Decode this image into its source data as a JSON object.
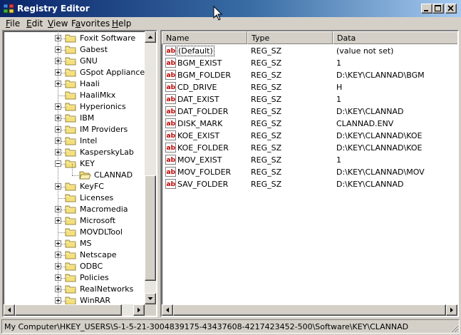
{
  "window": {
    "title": "Registry Editor"
  },
  "menu": [
    {
      "label": "File",
      "mnemonic": "F",
      "rest": "ile"
    },
    {
      "label": "Edit",
      "mnemonic": "E",
      "rest": "dit"
    },
    {
      "label": "View",
      "mnemonic": "V",
      "rest": "iew"
    },
    {
      "label": "Favorites",
      "mnemonic": "a",
      "pre": "F",
      "rest": "vorites"
    },
    {
      "label": "Help",
      "mnemonic": "H",
      "rest": "elp"
    }
  ],
  "tree": {
    "items": [
      {
        "label": "Foxit Software",
        "expander": "plus",
        "level": 0
      },
      {
        "label": "Gabest",
        "expander": "plus",
        "level": 0
      },
      {
        "label": "GNU",
        "expander": "plus",
        "level": 0
      },
      {
        "label": "GSpot Appliance Co",
        "expander": "plus",
        "level": 0
      },
      {
        "label": "Haali",
        "expander": "plus",
        "level": 0
      },
      {
        "label": "HaaliMkx",
        "expander": "none",
        "level": 0
      },
      {
        "label": "Hyperionics",
        "expander": "plus",
        "level": 0
      },
      {
        "label": "IBM",
        "expander": "plus",
        "level": 0
      },
      {
        "label": "IM Providers",
        "expander": "plus",
        "level": 0
      },
      {
        "label": "Intel",
        "expander": "plus",
        "level": 0
      },
      {
        "label": "KasperskyLab",
        "expander": "plus",
        "level": 0
      },
      {
        "label": "KEY",
        "expander": "minus",
        "level": 0
      },
      {
        "label": "CLANNAD",
        "expander": "none",
        "level": 1,
        "open": true
      },
      {
        "label": "KeyFC",
        "expander": "plus",
        "level": 0
      },
      {
        "label": "Licenses",
        "expander": "none",
        "level": 0
      },
      {
        "label": "Macromedia",
        "expander": "plus",
        "level": 0
      },
      {
        "label": "Microsoft",
        "expander": "plus",
        "level": 0
      },
      {
        "label": "MOVDLTool",
        "expander": "none",
        "level": 0
      },
      {
        "label": "MS",
        "expander": "plus",
        "level": 0
      },
      {
        "label": "Netscape",
        "expander": "plus",
        "level": 0
      },
      {
        "label": "ODBC",
        "expander": "plus",
        "level": 0
      },
      {
        "label": "Policies",
        "expander": "plus",
        "level": 0
      },
      {
        "label": "RealNetworks",
        "expander": "plus",
        "level": 0
      },
      {
        "label": "WinRAR",
        "expander": "plus",
        "level": 0
      }
    ]
  },
  "list": {
    "columns": {
      "name": "Name",
      "type": "Type",
      "data": "Data"
    },
    "rows": [
      {
        "name": "(Default)",
        "type": "REG_SZ",
        "data": "(value not set)"
      },
      {
        "name": "BGM_EXIST",
        "type": "REG_SZ",
        "data": "1"
      },
      {
        "name": "BGM_FOLDER",
        "type": "REG_SZ",
        "data": "D:\\KEY\\CLANNAD\\BGM"
      },
      {
        "name": "CD_DRIVE",
        "type": "REG_SZ",
        "data": "H"
      },
      {
        "name": "DAT_EXIST",
        "type": "REG_SZ",
        "data": "1"
      },
      {
        "name": "DAT_FOLDER",
        "type": "REG_SZ",
        "data": "D:\\KEY\\CLANNAD"
      },
      {
        "name": "DISK_MARK",
        "type": "REG_SZ",
        "data": "CLANNAD.ENV"
      },
      {
        "name": "KOE_EXIST",
        "type": "REG_SZ",
        "data": "D:\\KEY\\CLANNAD\\KOE"
      },
      {
        "name": "KOE_FOLDER",
        "type": "REG_SZ",
        "data": "D:\\KEY\\CLANNAD\\KOE"
      },
      {
        "name": "MOV_EXIST",
        "type": "REG_SZ",
        "data": "1"
      },
      {
        "name": "MOV_FOLDER",
        "type": "REG_SZ",
        "data": "D:\\KEY\\CLANNAD\\MOV"
      },
      {
        "name": "SAV_FOLDER",
        "type": "REG_SZ",
        "data": "D:\\KEY\\CLANNAD"
      }
    ]
  },
  "status": {
    "path": "My Computer\\HKEY_USERS\\S-1-5-21-3004839175-43437608-4217423452-500\\Software\\KEY\\CLANNAD"
  },
  "icons": {
    "app": "registry-editor-icon",
    "folder": "folder-icon",
    "folder_open": "open-folder-icon",
    "string_value": "ab-string-value-icon"
  },
  "colors": {
    "titlebar_start": "#0a246a",
    "titlebar_end": "#a6caf0",
    "face": "#d4d0c8",
    "folder": "#f4e07c"
  }
}
